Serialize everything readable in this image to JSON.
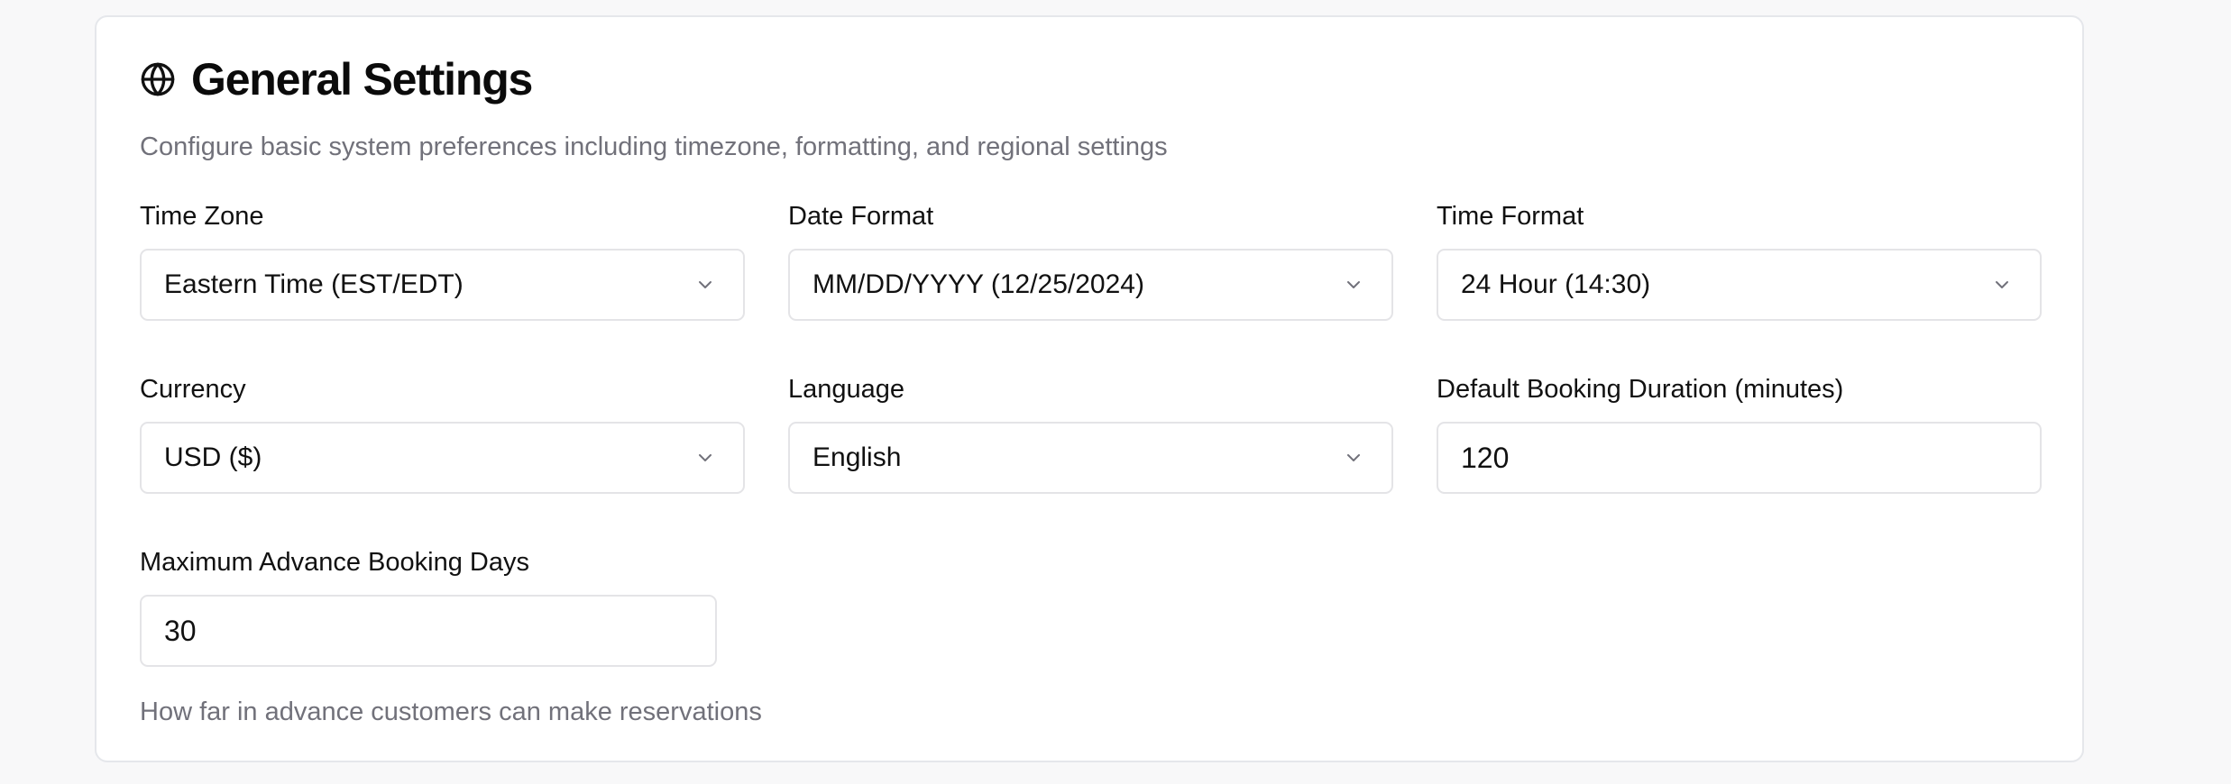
{
  "section": {
    "icon": "globe-icon",
    "title": "General Settings",
    "subtitle": "Configure basic system preferences including timezone, formatting, and regional settings"
  },
  "fields": {
    "time_zone": {
      "label": "Time Zone",
      "value": "Eastern Time (EST/EDT)"
    },
    "date_format": {
      "label": "Date Format",
      "value": "MM/DD/YYYY (12/25/2024)"
    },
    "time_format": {
      "label": "Time Format",
      "value": "24 Hour (14:30)"
    },
    "currency": {
      "label": "Currency",
      "value": "USD ($)"
    },
    "language": {
      "label": "Language",
      "value": "English"
    },
    "default_booking_duration": {
      "label": "Default Booking Duration (minutes)",
      "value": "120"
    },
    "max_advance_booking_days": {
      "label": "Maximum Advance Booking Days",
      "value": "30",
      "help": "How far in advance customers can make reservations"
    }
  }
}
